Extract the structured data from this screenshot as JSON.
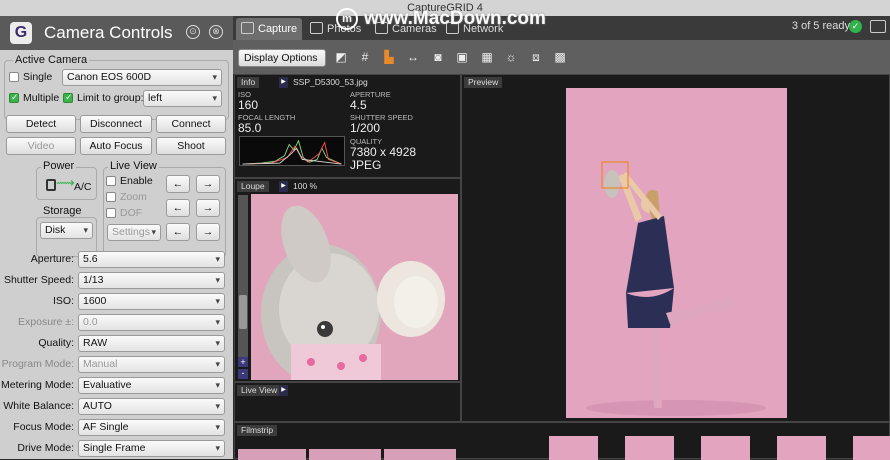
{
  "window": {
    "title": "CaptureGRID 4"
  },
  "watermark": {
    "text": "www.MacDown.com",
    "logo": "m"
  },
  "panel": {
    "title": "Camera Controls",
    "logo": "G",
    "icon1": "⊙",
    "icon2": "⊗"
  },
  "active_camera": {
    "label": "Active Camera",
    "single_label": "Single",
    "camera": "Canon EOS 600D",
    "multiple_label": "Multiple",
    "limit_label": "Limit to group:",
    "group": "left"
  },
  "buttons": {
    "detect": "Detect",
    "disconnect": "Disconnect",
    "connect": "Connect",
    "video": "Video",
    "autofocus": "Auto Focus",
    "shoot": "Shoot"
  },
  "power": {
    "label": "Power",
    "value": "A/C"
  },
  "liveview": {
    "label": "Live View",
    "enable": "Enable",
    "zoom": "Zoom",
    "dof": "DOF",
    "settings": "Settings"
  },
  "storage": {
    "label": "Storage",
    "value": "Disk"
  },
  "settings": [
    {
      "label": "Aperture:",
      "value": "5.6",
      "disabled": false
    },
    {
      "label": "Shutter Speed:",
      "value": "1/13",
      "disabled": false
    },
    {
      "label": "ISO:",
      "value": "1600",
      "disabled": false
    },
    {
      "label": "Exposure ±:",
      "value": "0.0",
      "disabled": true
    },
    {
      "label": "Quality:",
      "value": "RAW",
      "disabled": false
    },
    {
      "label": "Program Mode:",
      "value": "Manual",
      "disabled": true
    },
    {
      "label": "Metering Mode:",
      "value": "Evaluative",
      "disabled": false
    },
    {
      "label": "White Balance:",
      "value": "AUTO",
      "disabled": false
    },
    {
      "label": "Focus Mode:",
      "value": "AF Single",
      "disabled": false
    },
    {
      "label": "Drive Mode:",
      "value": "Single Frame",
      "disabled": false
    }
  ],
  "tabs": [
    {
      "label": "Capture"
    },
    {
      "label": "Photos"
    },
    {
      "label": "Cameras"
    },
    {
      "label": "Network"
    }
  ],
  "status": {
    "text": "3 of 5 ready"
  },
  "toolbar": {
    "display_options": "Display Options"
  },
  "info": {
    "tag": "Info",
    "file": "SSP_D5300_53.jpg",
    "iso_label": "ISO",
    "iso": "160",
    "aperture_label": "APERTURE",
    "aperture": "4.5",
    "focal_label": "FOCAL LENGTH",
    "focal": "85.0",
    "shutter_label": "SHUTTER SPEED",
    "shutter": "1/200",
    "quality_label": "QUALITY",
    "quality": "7380 x 4928",
    "format": "JPEG"
  },
  "loupe": {
    "tag": "Loupe",
    "zoom": "100 %",
    "plus": "+",
    "minus": "-"
  },
  "liveview_pane": {
    "tag": "Live View"
  },
  "preview": {
    "tag": "Preview"
  },
  "filmstrip": {
    "tag": "Filmstrip"
  }
}
